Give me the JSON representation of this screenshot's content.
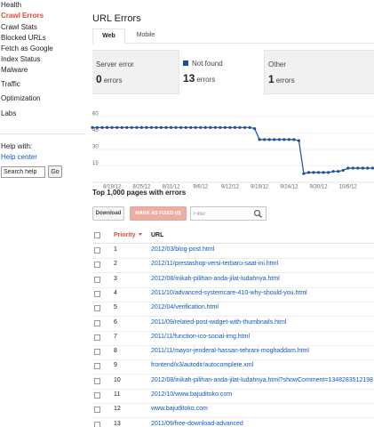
{
  "sidebar": {
    "items": [
      {
        "label": "Health",
        "active": false
      },
      {
        "label": "Crawl Errors",
        "active": true
      },
      {
        "label": "Crawl Stats",
        "active": false
      },
      {
        "label": "Blocked URLs",
        "active": false
      },
      {
        "label": "Fetch as Google",
        "active": false
      },
      {
        "label": "Index Status",
        "active": false
      },
      {
        "label": "Malware",
        "active": false
      },
      {
        "label": "Traffic",
        "active": false
      },
      {
        "label": "Optimization",
        "active": false
      },
      {
        "label": "Labs",
        "active": false
      }
    ],
    "help_with": "Help with:",
    "help_center": "Help center",
    "search_placeholder": "Search help",
    "go_label": "Go"
  },
  "page_title": "URL Errors",
  "tabs": [
    {
      "label": "Web",
      "active": true
    },
    {
      "label": "Mobile",
      "active": false
    }
  ],
  "summary": {
    "server": {
      "label": "Server error",
      "count": "0",
      "unit": "errors"
    },
    "not_found": {
      "label": "Not found",
      "count": "13",
      "unit": "errors"
    },
    "other": {
      "label": "Other",
      "count": "1",
      "unit": "errors"
    }
  },
  "chart_data": {
    "type": "line",
    "series": [
      {
        "name": "Not found",
        "color": "#1c4fa0"
      }
    ],
    "x": [
      "8/15/12",
      "8/16/12",
      "8/17/12",
      "8/18/12",
      "8/19/12",
      "8/20/12",
      "8/21/12",
      "8/22/12",
      "8/23/12",
      "8/24/12",
      "8/25/12",
      "8/26/12",
      "8/27/12",
      "8/28/12",
      "8/29/12",
      "8/30/12",
      "8/31/12",
      "9/1/12",
      "9/2/12",
      "9/3/12",
      "9/4/12",
      "9/5/12",
      "9/6/12",
      "9/7/12",
      "9/8/12",
      "9/9/12",
      "9/10/12",
      "9/11/12",
      "9/12/12",
      "9/13/12",
      "9/14/12",
      "9/15/12",
      "9/16/12",
      "9/17/12",
      "9/18/12",
      "9/19/12",
      "9/20/12",
      "9/21/12",
      "9/22/12",
      "9/23/12",
      "9/24/12",
      "9/25/12",
      "9/26/12",
      "9/27/12",
      "9/28/12",
      "9/29/12",
      "9/30/12",
      "10/1/12",
      "10/2/12",
      "10/3/12",
      "10/4/12",
      "10/5/12",
      "10/6/12",
      "10/7/12",
      "10/8/12",
      "10/9/12",
      "10/10/12",
      "10/11/12"
    ],
    "y": [
      50,
      50,
      50,
      50,
      50,
      50,
      50,
      50,
      50,
      50,
      50,
      50,
      50,
      50,
      50,
      50,
      50,
      50,
      50,
      50,
      50,
      50,
      50,
      50,
      50,
      50,
      50,
      50,
      50,
      50,
      50,
      50,
      50,
      49,
      39,
      39,
      39,
      39,
      39,
      39,
      39,
      39,
      38,
      8,
      9,
      9,
      9,
      9,
      9,
      10,
      10,
      11,
      13,
      13,
      13,
      13,
      13,
      13
    ],
    "y_ticks": [
      "15",
      "30",
      "45",
      "60"
    ],
    "x_ticks": [
      "8/19/12",
      "8/25/12",
      "8/31/12",
      "9/6/12",
      "9/12/12",
      "9/18/12",
      "9/24/12",
      "9/30/12",
      "10/6/12"
    ],
    "ylim": [
      0,
      60
    ],
    "grid": true,
    "legend": "none"
  },
  "top_pages_title": "Top 1,000 pages with errors",
  "toolbar": {
    "download_label": "Download",
    "mark_fixed_label": "MARK AS FIXED (0)",
    "filter_placeholder": "Filter"
  },
  "table": {
    "headers": {
      "priority": "Priority",
      "url": "URL"
    },
    "rows": [
      {
        "priority": "1",
        "url": "2012/03/blog-post.html"
      },
      {
        "priority": "2",
        "url": "2012/11/prestashop-versi-terbaru-saat-ini.html"
      },
      {
        "priority": "3",
        "url": "2012/08/inikah-pilihan-anda-jilat-ludahnya.html"
      },
      {
        "priority": "4",
        "url": "2011/10/advanced-systemcare-410-why-should-you.html"
      },
      {
        "priority": "5",
        "url": "2012/04/verification.html"
      },
      {
        "priority": "6",
        "url": "2011/09/related-post-widget-with-thumbnails.html"
      },
      {
        "priority": "7",
        "url": "2011/11/function-ico-social-img.html"
      },
      {
        "priority": "8",
        "url": "2011/11/mayor-jenderal-hassan-tehrani-moghaddam.html"
      },
      {
        "priority": "9",
        "url": "frontend/x3/autodir/autocomplete.xml"
      },
      {
        "priority": "10",
        "url": "2012/08/inikah-pilihan-anda-jilat-ludahnya.html?showComment=1348283512198"
      },
      {
        "priority": "11",
        "url": "2012/10/www.bajuditoko.com"
      },
      {
        "priority": "12",
        "url": "www.bajuditoko.com"
      },
      {
        "priority": "13",
        "url": "2011/09/free-download-advanced"
      }
    ]
  }
}
